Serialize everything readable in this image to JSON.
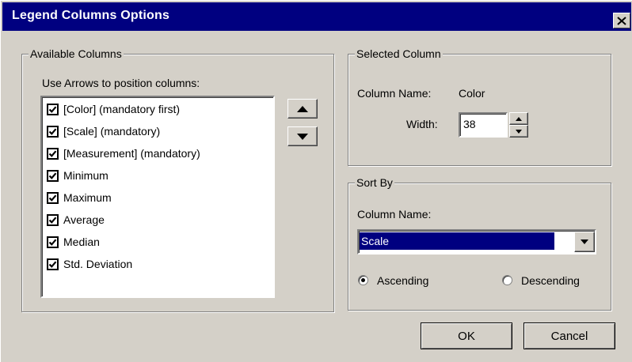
{
  "window": {
    "title": "Legend Columns Options"
  },
  "available": {
    "group_label": "Available Columns",
    "hint": "Use Arrows to position columns:",
    "items": [
      {
        "label": "[Color] (mandatory first)",
        "checked": true
      },
      {
        "label": "[Scale] (mandatory)",
        "checked": true
      },
      {
        "label": "[Measurement] (mandatory)",
        "checked": true
      },
      {
        "label": "Minimum",
        "checked": true
      },
      {
        "label": "Maximum",
        "checked": true
      },
      {
        "label": "Average",
        "checked": true
      },
      {
        "label": "Median",
        "checked": true
      },
      {
        "label": "Std. Deviation",
        "checked": true
      }
    ]
  },
  "selected": {
    "group_label": "Selected Column",
    "name_label": "Column Name:",
    "name_value": "Color",
    "width_label": "Width:",
    "width_value": "38"
  },
  "sort": {
    "group_label": "Sort By",
    "column_label": "Column Name:",
    "column_value": "Scale",
    "ascending_label": "Ascending",
    "descending_label": "Descending",
    "selected_order": "ascending"
  },
  "buttons": {
    "ok": "OK",
    "cancel": "Cancel"
  },
  "colors": {
    "titlebar": "#000080",
    "face": "#d4d0c8",
    "selection": "#000080"
  }
}
